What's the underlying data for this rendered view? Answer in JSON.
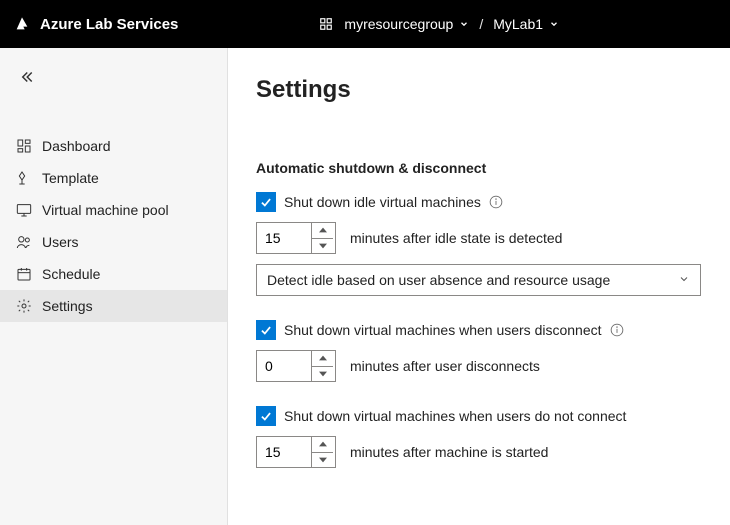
{
  "brand": "Azure Lab Services",
  "breadcrumb": {
    "resource_group": "myresourcegroup",
    "lab": "MyLab1",
    "sep": "/"
  },
  "sidebar": {
    "items": [
      {
        "label": "Dashboard"
      },
      {
        "label": "Template"
      },
      {
        "label": "Virtual machine pool"
      },
      {
        "label": "Users"
      },
      {
        "label": "Schedule"
      },
      {
        "label": "Settings"
      }
    ]
  },
  "page": {
    "title": "Settings",
    "section_title": "Automatic shutdown & disconnect",
    "shutdown_idle": {
      "label": "Shut down idle virtual machines",
      "minutes": "15",
      "minutes_label": "minutes after idle state is detected",
      "detect_mode": "Detect idle based on user absence and resource usage"
    },
    "shutdown_disconnect": {
      "label": "Shut down virtual machines when users disconnect",
      "minutes": "0",
      "minutes_label": "minutes after user disconnects"
    },
    "shutdown_noconnect": {
      "label": "Shut down virtual machines when users do not connect",
      "minutes": "15",
      "minutes_label": "minutes after machine is started"
    }
  }
}
